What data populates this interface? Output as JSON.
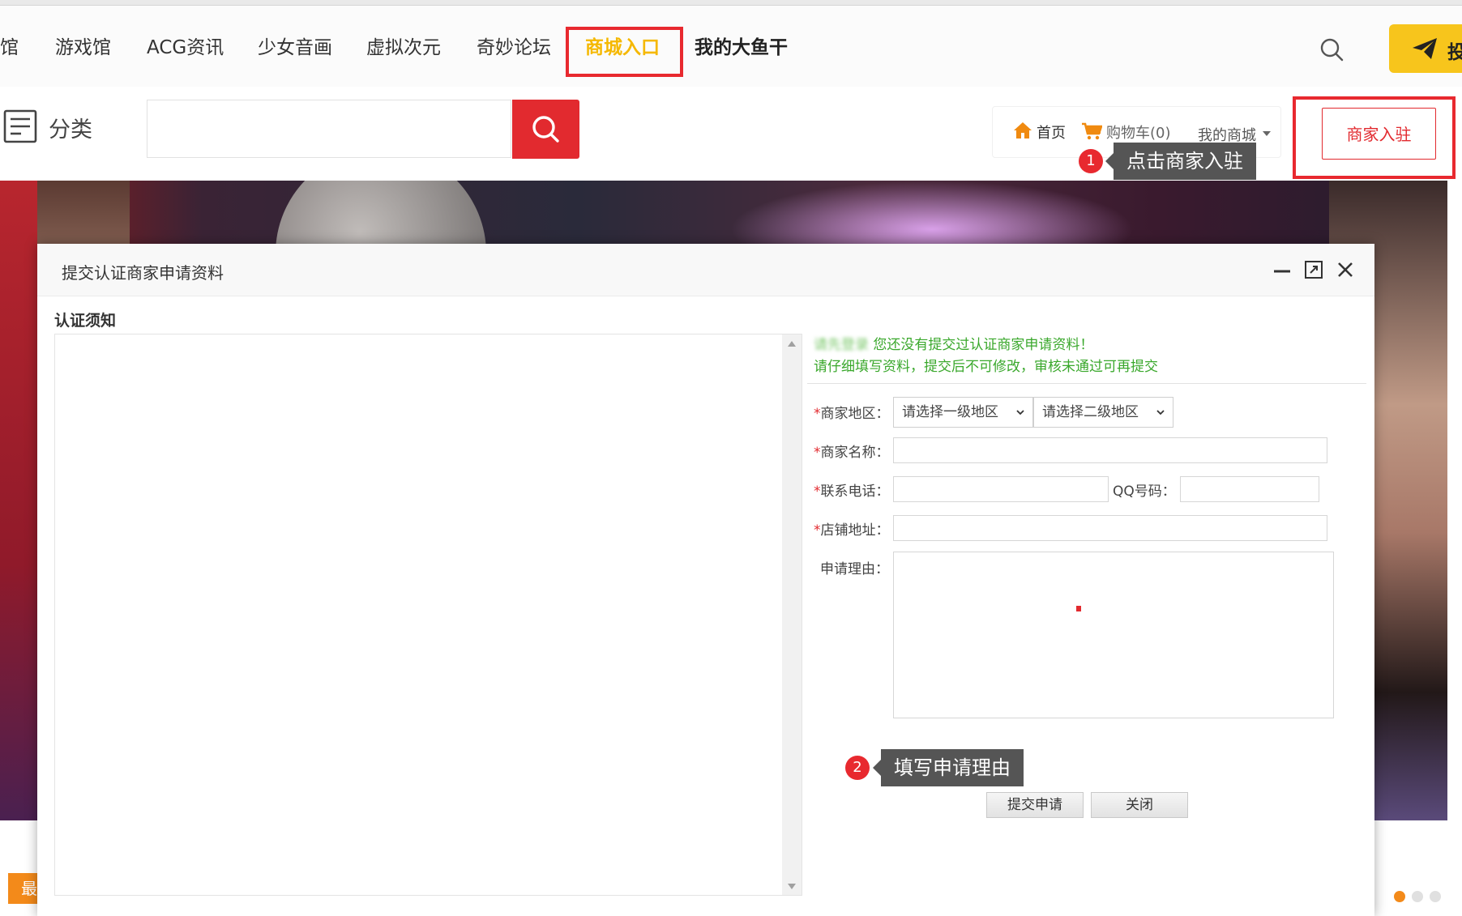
{
  "nav": {
    "items": [
      "馆",
      "游戏馆",
      "ACG资讯",
      "少女音画",
      "虚拟次元",
      "奇妙论坛",
      "商城入口",
      "我的大鱼干"
    ],
    "active": "商城入口",
    "post_label": "投"
  },
  "header": {
    "category_label": "分类",
    "search_value": "",
    "home_label": "首页",
    "cart_label": "购物车(0)",
    "my_mall_label": "我的商城",
    "merchant_join_label": "商家入驻"
  },
  "tips": {
    "step1_number": "1",
    "step1_text": "点击商家入驻",
    "step2_number": "2",
    "step2_text": "填写申请理由"
  },
  "footer": {
    "latest_tag": "最"
  },
  "modal": {
    "title": "提交认证商家申请资料",
    "notice_label": "认证须知",
    "msg_blurred": "请先登录",
    "msg_line1": "您还没有提交过认证商家申请资料！",
    "msg_line2": "请仔细填写资料，提交后不可修改，审核未通过可再提交",
    "form": {
      "region_label": "商家地区：",
      "region1_value": "请选择一级地区",
      "region2_value": "请选择二级地区",
      "name_label": "商家名称：",
      "phone_label": "联系电话：",
      "qq_label": "QQ号码：",
      "address_label": "店铺地址：",
      "reason_label": "申请理由：",
      "name_value": "",
      "phone_value": "",
      "qq_value": "",
      "address_value": "",
      "reason_value": ""
    },
    "submit_label": "提交申请",
    "close_label": "关闭"
  },
  "colors": {
    "accent_red": "#e22a2f",
    "nav_active": "#f5b800",
    "notice_green": "#3aa82c",
    "post_yellow": "#f7c51c"
  }
}
